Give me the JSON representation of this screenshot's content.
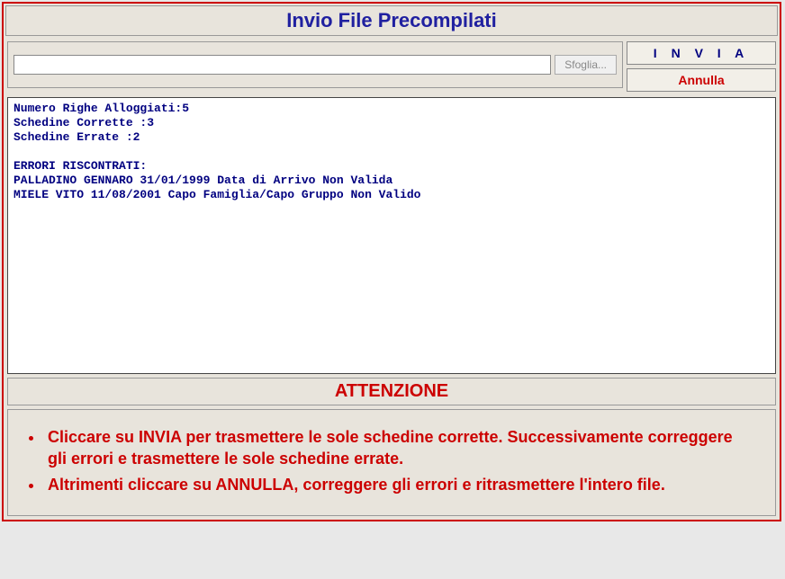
{
  "title": "Invio File Precompilati",
  "upload": {
    "file_value": "",
    "browse_label": "Sfoglia..."
  },
  "buttons": {
    "invia": "I N V I A",
    "annulla": "Annulla"
  },
  "log": {
    "lines": [
      "Numero Righe Alloggiati:5",
      "Schedine Corrette :3",
      "Schedine Errate :2",
      "",
      "ERRORI RISCONTRATI:",
      "PALLADINO GENNARO 31/01/1999 Data di Arrivo Non Valida",
      "MIELE VITO 11/08/2001 Capo Famiglia/Capo Gruppo Non Valido"
    ]
  },
  "attention": {
    "heading": "ATTENZIONE",
    "items": [
      "Cliccare su INVIA per trasmettere le sole schedine corrette. Successivamente correggere gli errori e trasmettere le sole schedine errate.",
      "Altrimenti cliccare su ANNULLA, correggere gli errori e ritrasmettere l'intero file."
    ]
  }
}
